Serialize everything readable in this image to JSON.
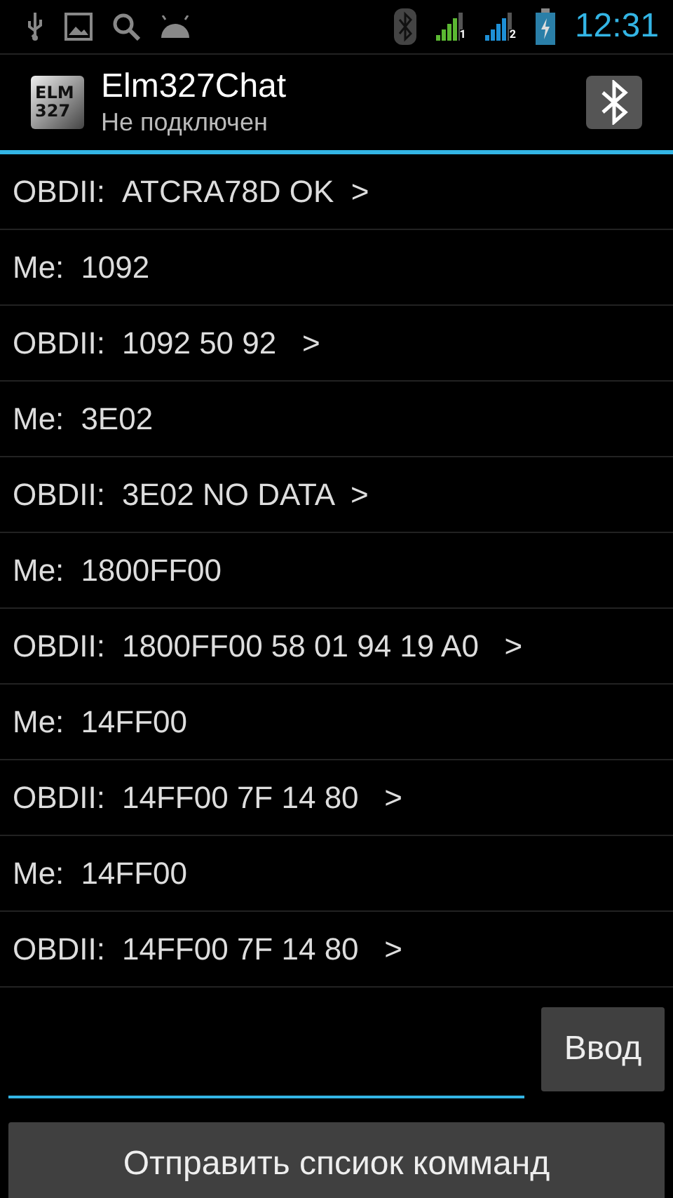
{
  "status_bar": {
    "time": "12:31",
    "sim_labels": [
      "1",
      "2"
    ]
  },
  "action_bar": {
    "logo_lines": [
      "ELM",
      "327"
    ],
    "title": "Elm327Chat",
    "subtitle": "Не подключен"
  },
  "messages": [
    {
      "sender": "OBDII:",
      "text": "ATCRA78D OK  >"
    },
    {
      "sender": "Me:",
      "text": "1092"
    },
    {
      "sender": "OBDII:",
      "text": "1092 50 92   >"
    },
    {
      "sender": "Me:",
      "text": "3E02"
    },
    {
      "sender": "OBDII:",
      "text": "3E02 NO DATA  >"
    },
    {
      "sender": "Me:",
      "text": "1800FF00"
    },
    {
      "sender": "OBDII:",
      "text": "1800FF00 58 01 94 19 A0   >"
    },
    {
      "sender": "Me:",
      "text": "14FF00"
    },
    {
      "sender": "OBDII:",
      "text": "14FF00 7F 14 80   >"
    },
    {
      "sender": "Me:",
      "text": "14FF00"
    },
    {
      "sender": "OBDII:",
      "text": "14FF00 7F 14 80   >"
    }
  ],
  "input": {
    "send_button": "Ввод"
  },
  "send_list_button": "Отправить спсиок комманд"
}
